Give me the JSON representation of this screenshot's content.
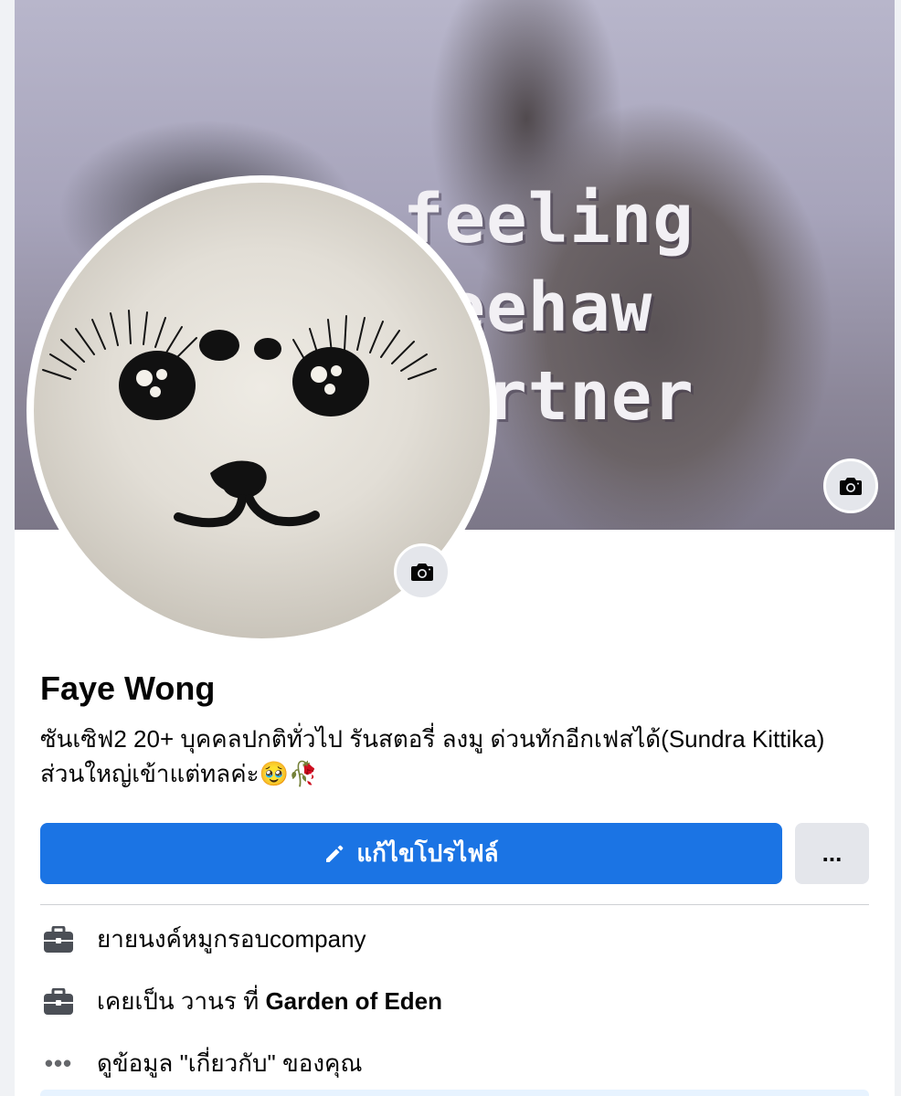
{
  "cover": {
    "text_lines": [
      "feeling",
      "yeehaw",
      "partner"
    ],
    "camera_icon": "camera-icon"
  },
  "avatar": {
    "camera_icon": "camera-icon"
  },
  "profile": {
    "name": "Faye Wong",
    "bio": "ซันเซิฟ2 20+ บุคคลปกติทั่วไป รันสตอรี่ ลงมู ด่วนทักอีกเฟสได้(Sundra Kittika) ส่วนใหญ่เข้าแต่ทลค่ะ🥹🥀"
  },
  "actions": {
    "edit_profile_label": "แก้ไขโปรไฟล์",
    "edit_icon": "pencil-icon",
    "more_label": "..."
  },
  "info": {
    "work_current": "ยายนงค์หมูกรอบcompany",
    "work_past_prefix": "เคยเป็น วานร ที่ ",
    "work_past_place": "Garden of Eden",
    "about_label": "ดูข้อมูล \"เกี่ยวกับ\" ของคุณ",
    "briefcase_icon": "briefcase-icon",
    "more_icon": "more-dots-icon"
  },
  "colors": {
    "primary_button": "#1b74e4",
    "secondary_button": "#e4e6eb",
    "text": "#050505"
  }
}
